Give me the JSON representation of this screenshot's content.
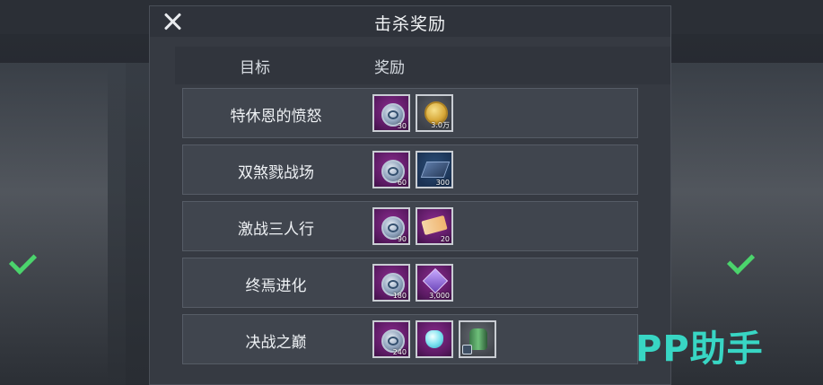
{
  "panel": {
    "title": "击杀奖励",
    "headers": {
      "target": "目标",
      "reward": "奖励"
    }
  },
  "rows": [
    {
      "name": "特休恩的愤怒",
      "rewards": [
        {
          "icon": "silver-coin-icon",
          "quantity": "30"
        },
        {
          "icon": "gold-coin-icon",
          "quantity": "3.0万"
        }
      ]
    },
    {
      "name": "双煞戮战场",
      "rewards": [
        {
          "icon": "silver-coin-icon",
          "quantity": "60"
        },
        {
          "icon": "blue-cube-icon",
          "quantity": "300"
        }
      ]
    },
    {
      "name": "激战三人行",
      "rewards": [
        {
          "icon": "silver-coin-icon",
          "quantity": "90"
        },
        {
          "icon": "ticket-icon",
          "quantity": "20"
        }
      ]
    },
    {
      "name": "终焉进化",
      "rewards": [
        {
          "icon": "silver-coin-icon",
          "quantity": "180"
        },
        {
          "icon": "purple-gem-icon",
          "quantity": "3,000"
        }
      ]
    },
    {
      "name": "决战之巅",
      "rewards": [
        {
          "icon": "silver-coin-icon",
          "quantity": "240"
        },
        {
          "icon": "crystal-icon",
          "quantity": ""
        },
        {
          "icon": "green-can-icon",
          "quantity": ""
        }
      ]
    }
  ],
  "watermark": "PP助手",
  "colors": {
    "panel_bg": "#363a42",
    "row_bg": "#40454e",
    "rare_purple": "#5b1a63",
    "watermark": "#38d6c4"
  }
}
